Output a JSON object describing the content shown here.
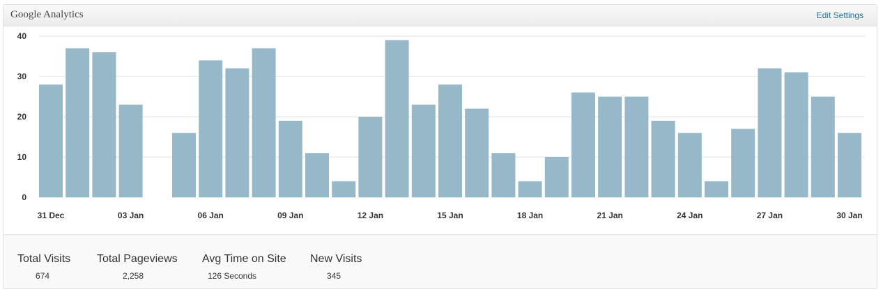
{
  "widget": {
    "title": "Google Analytics",
    "edit_label": "Edit Settings"
  },
  "colors": {
    "bar": "#96b8c8",
    "grid": "#e0e0e0",
    "accent_link": "#21759b"
  },
  "chart_data": {
    "type": "bar",
    "title": "",
    "xlabel": "",
    "ylabel": "",
    "ylim": [
      0,
      40
    ],
    "yticks": [
      0,
      10,
      20,
      30,
      40
    ],
    "grid": true,
    "categories": [
      "31 Dec",
      "01 Jan",
      "02 Jan",
      "03 Jan",
      "04 Jan",
      "05 Jan",
      "06 Jan",
      "07 Jan",
      "08 Jan",
      "09 Jan",
      "10 Jan",
      "11 Jan",
      "12 Jan",
      "13 Jan",
      "14 Jan",
      "15 Jan",
      "16 Jan",
      "17 Jan",
      "18 Jan",
      "19 Jan",
      "20 Jan",
      "21 Jan",
      "22 Jan",
      "23 Jan",
      "24 Jan",
      "25 Jan",
      "26 Jan",
      "27 Jan",
      "28 Jan",
      "29 Jan",
      "30 Jan",
      "31 Jan"
    ],
    "values": [
      28,
      37,
      36,
      23,
      0,
      16,
      34,
      32,
      37,
      19,
      11,
      4,
      20,
      39,
      23,
      28,
      22,
      11,
      4,
      10,
      26,
      25,
      25,
      19,
      16,
      4,
      17,
      32,
      31,
      25,
      16
    ],
    "xtick_labels": [
      {
        "index": 0,
        "label": "31 Dec"
      },
      {
        "index": 3,
        "label": "03 Jan"
      },
      {
        "index": 6,
        "label": "06 Jan"
      },
      {
        "index": 9,
        "label": "09 Jan"
      },
      {
        "index": 12,
        "label": "12 Jan"
      },
      {
        "index": 15,
        "label": "15 Jan"
      },
      {
        "index": 18,
        "label": "18 Jan"
      },
      {
        "index": 21,
        "label": "21 Jan"
      },
      {
        "index": 24,
        "label": "24 Jan"
      },
      {
        "index": 27,
        "label": "27 Jan"
      },
      {
        "index": 30,
        "label": "30 Jan"
      }
    ]
  },
  "stats": [
    {
      "label": "Total Visits",
      "value": "674"
    },
    {
      "label": "Total Pageviews",
      "value": "2,258"
    },
    {
      "label": "Avg Time on Site",
      "value": "126 Seconds"
    },
    {
      "label": "New Visits",
      "value": "345"
    }
  ]
}
